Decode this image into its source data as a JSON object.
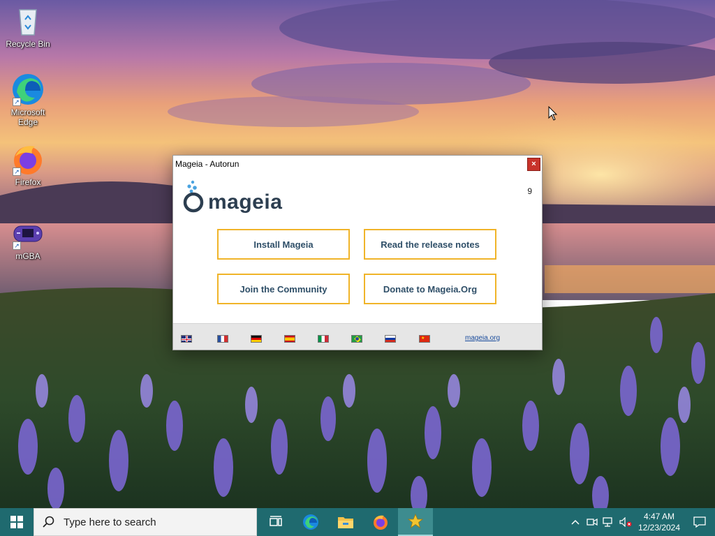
{
  "desktop": {
    "icons": [
      {
        "label": "Recycle Bin",
        "icon": "recycle-bin-icon"
      },
      {
        "label": "Microsoft Edge",
        "icon": "edge-icon"
      },
      {
        "label": "Firefox",
        "icon": "firefox-icon"
      },
      {
        "label": "mGBA",
        "icon": "mgba-icon"
      }
    ]
  },
  "window": {
    "title": "Mageia - Autorun",
    "close_label": "×",
    "logo_text": "mageia",
    "version": "9",
    "buttons": {
      "install": "Install Mageia",
      "release_notes": "Read the release notes",
      "community": "Join the Community",
      "donate": "Donate to Mageia.Org"
    },
    "footer": {
      "languages": [
        "English",
        "French",
        "German",
        "Spanish",
        "Italian",
        "Portuguese (Brazil)",
        "Russian",
        "Chinese"
      ],
      "link": "mageia.org"
    },
    "colors": {
      "button_border": "#f0b429",
      "button_text": "#2f4f68",
      "footer_bg": "#e6e6e6",
      "close_bg": "#c8332b"
    }
  },
  "taskbar": {
    "search_placeholder": "Type here to search",
    "apps": [
      "task-view-icon",
      "edge-icon",
      "file-explorer-icon",
      "firefox-icon",
      "mageia-autorun-icon"
    ],
    "active_app": "mageia-autorun-icon",
    "clock": {
      "time": "4:47 AM",
      "date": "12/23/2024"
    },
    "color": "#1f6a6f"
  }
}
